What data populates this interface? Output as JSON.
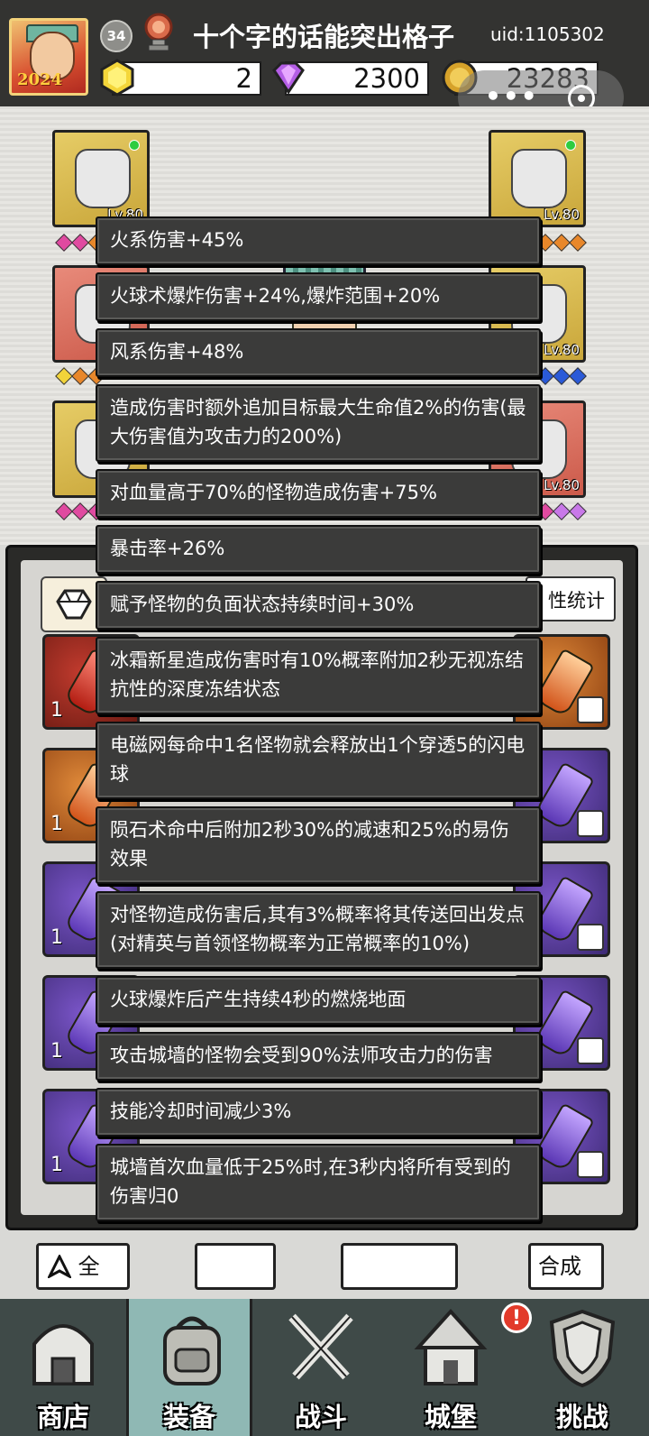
{
  "header": {
    "avatar_year": "2024",
    "level": "34",
    "username": "十个字的话能突出格子",
    "uid": "uid:1105302"
  },
  "resources": [
    {
      "name": "yellow-gem",
      "value": "2",
      "color": "#f2d43a"
    },
    {
      "name": "purple-diamond",
      "value": "2300",
      "color": "#b05ae0"
    },
    {
      "name": "gold-coin",
      "value": "23283",
      "color": "#d4a02a"
    }
  ],
  "equipment": {
    "slot_level": "Lv.80"
  },
  "gem_panel": {
    "stats_button": "性统计",
    "counts": [
      "1",
      "1",
      "1",
      "1",
      "1"
    ]
  },
  "tooltips": [
    "火系伤害+45%",
    "火球术爆炸伤害+24%,爆炸范围+20%",
    "风系伤害+48%",
    "造成伤害时额外追加目标最大生命值2%的伤害(最大伤害值为攻击力的200%)",
    "对血量高于70%的怪物造成伤害+75%",
    "暴击率+26%",
    "赋予怪物的负面状态持续时间+30%",
    "冰霜新星造成伤害时有10%概率附加2秒无视冻结抗性的深度冻结状态",
    "电磁网每命中1名怪物就会释放出1个穿透5的闪电球",
    "陨石术命中后附加2秒30%的减速和25%的易伤效果",
    "对怪物造成伤害后,其有3%概率将其传送回出发点(对精英与首领怪物概率为正常概率的10%)",
    "火球爆炸后产生持续4秒的燃烧地面",
    "攻击城墙的怪物会受到90%法师攻击力的伤害",
    "技能冷却时间减少3%",
    "城墙首次血量低于25%时,在3秒内将所有受到的伤害归0"
  ],
  "bottom_buttons": {
    "left": "全",
    "right": "合成"
  },
  "nav": {
    "items": [
      {
        "label": "商店",
        "icon": "shop-icon"
      },
      {
        "label": "装备",
        "icon": "backpack-icon"
      },
      {
        "label": "战斗",
        "icon": "crossed-swords-icon"
      },
      {
        "label": "城堡",
        "icon": "castle-icon"
      },
      {
        "label": "挑战",
        "icon": "shield-icon"
      }
    ],
    "notification": "!",
    "active_color": "#8fb8b4"
  }
}
